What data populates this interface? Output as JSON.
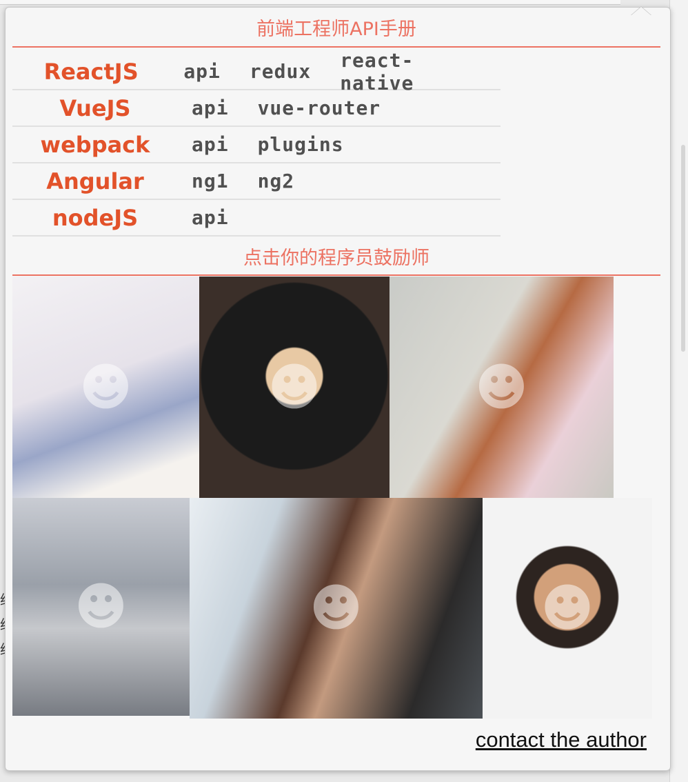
{
  "header": {
    "title": "前端工程师API手册"
  },
  "frameworks": [
    {
      "name": "ReactJS",
      "links": [
        "api",
        "redux",
        "react-native"
      ]
    },
    {
      "name": "VueJS",
      "links": [
        "api",
        "vue-router"
      ]
    },
    {
      "name": "webpack",
      "links": [
        "api",
        "plugins"
      ]
    },
    {
      "name": "Angular",
      "links": [
        "ng1",
        "ng2"
      ]
    },
    {
      "name": "nodeJS",
      "links": [
        "api"
      ]
    }
  ],
  "motivators": {
    "title": "点击你的程序员鼓励师",
    "photos": [
      {
        "icon": "person-photo-icon"
      },
      {
        "icon": "person-photo-icon"
      },
      {
        "icon": "person-photo-icon"
      },
      {
        "icon": "person-photo-icon"
      },
      {
        "icon": "person-photo-icon"
      },
      {
        "icon": "person-photo-icon"
      }
    ]
  },
  "footer": {
    "contact_label": "contact the author"
  },
  "colors": {
    "accent": "#ec7262",
    "framework": "#e2522a",
    "link": "#505050"
  }
}
